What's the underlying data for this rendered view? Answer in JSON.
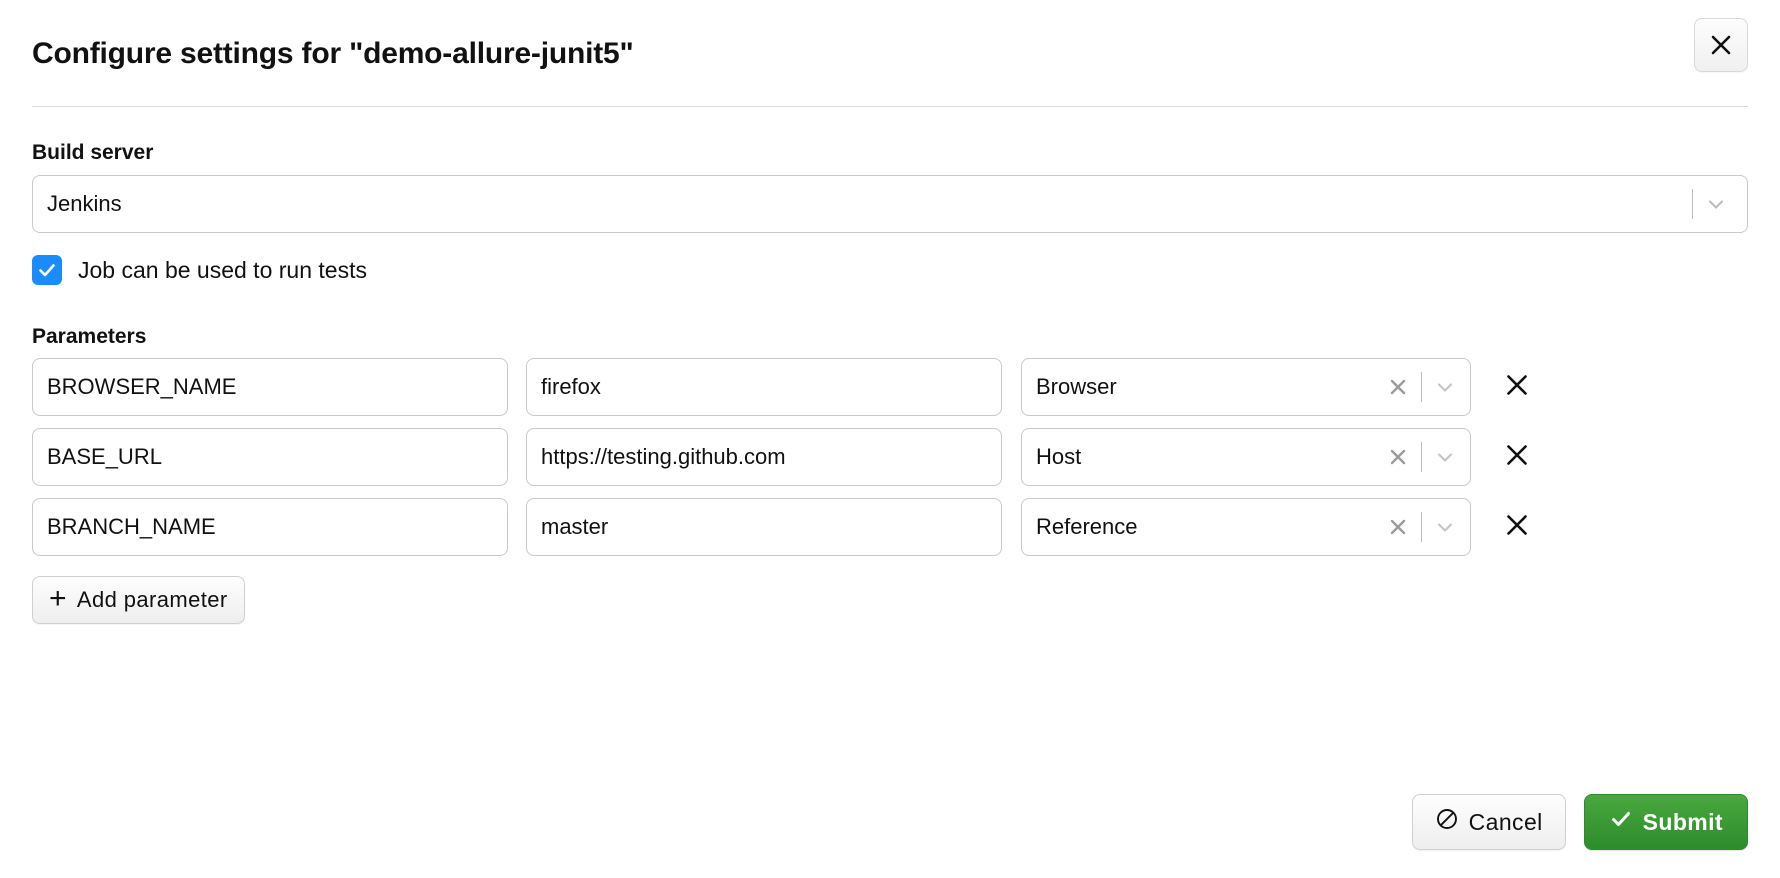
{
  "dialog": {
    "title": "Configure settings for \"demo-allure-junit5\"",
    "close_icon": "close-icon"
  },
  "build_server": {
    "label": "Build server",
    "selected": "Jenkins",
    "chevron_icon": "chevron-down-icon"
  },
  "job_checkbox": {
    "label": "Job can be used to run tests",
    "checked": true,
    "check_icon": "check-icon",
    "color": "#1a8cff"
  },
  "parameters": {
    "label": "Parameters",
    "rows": [
      {
        "name": "BROWSER_NAME",
        "value": "firefox",
        "type": "Browser",
        "clear_icon": "clear-icon",
        "chevron_icon": "chevron-down-icon",
        "remove_icon": "remove-row-icon"
      },
      {
        "name": "BASE_URL",
        "value": "https://testing.github.com",
        "type": "Host",
        "clear_icon": "clear-icon",
        "chevron_icon": "chevron-down-icon",
        "remove_icon": "remove-row-icon"
      },
      {
        "name": "BRANCH_NAME",
        "value": "master",
        "type": "Reference",
        "clear_icon": "clear-icon",
        "chevron_icon": "chevron-down-icon",
        "remove_icon": "remove-row-icon"
      }
    ],
    "add_button": {
      "plus": "+",
      "label": "Add parameter"
    }
  },
  "footer": {
    "cancel_label": "Cancel",
    "cancel_icon": "prohibited-icon",
    "submit_label": "Submit",
    "submit_icon": "check-icon",
    "submit_color": "#2d8c2b"
  }
}
